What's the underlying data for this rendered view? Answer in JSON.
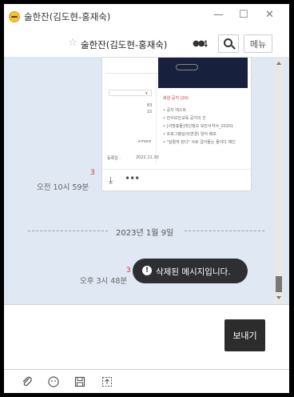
{
  "window": {
    "title": "술한잔(김도현-홍재숙)",
    "minimize": "—",
    "maximize": "☐",
    "close": "✕"
  },
  "header": {
    "room_name": "술한잔(김도현-홍재숙)",
    "member_count": "4",
    "menu_label": "메뉴"
  },
  "shared_image": {
    "lines": [
      "회원 공지 (20)",
      "• 공지 테스트",
      "• 전사보안교육 공지의 건",
      "• [서명충돌]개인정보 보안서약서_20201",
      "• 프로그램심의(변경) 양식 배포",
      "• \"날렸게 된다\" 사로 걸어들는 들이다 채인"
    ],
    "left_numbers": [
      "83",
      "15"
    ],
    "more_text": "+more",
    "date_text": "2022.11.30"
  },
  "messages": [
    {
      "unread": "3",
      "time": "오전 10시 59분"
    },
    {
      "unread": "3",
      "time": "오후 3시 48분",
      "text": "삭제된 메시지입니다."
    }
  ],
  "date_divider": "2023년 1월 9일",
  "composer": {
    "send_label": "보내기"
  },
  "toolbar_icons": [
    "paperclip-icon",
    "emoji-icon",
    "save-icon",
    "capture-icon"
  ]
}
